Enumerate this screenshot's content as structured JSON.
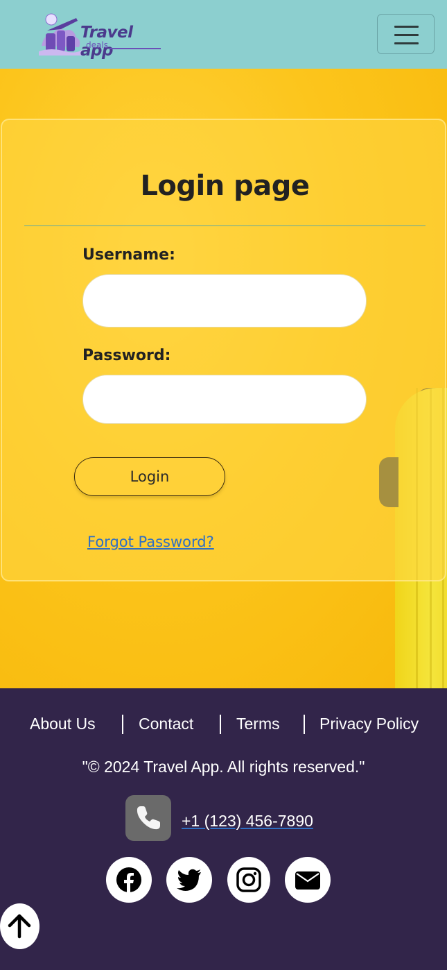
{
  "header": {
    "brand_title": "Travel app",
    "brand_subtitle": "deals",
    "menu_icon": "hamburger-icon"
  },
  "login_card": {
    "title": "Login page",
    "username_label": "Username:",
    "username_value": "",
    "password_label": "Password:",
    "password_value": "",
    "login_button": "Login",
    "forgot_link": "Forgot Password?"
  },
  "footer": {
    "links": [
      "About Us",
      "Contact",
      "Terms",
      "Privacy Policy"
    ],
    "copyright": "\"© 2024 Travel App. All rights reserved.\"",
    "phone": " +1 (123) 456-7890",
    "social_icons": [
      "facebook-icon",
      "twitter-icon",
      "instagram-icon",
      "envelope-icon"
    ],
    "back_to_top_icon": "arrow-up-icon"
  },
  "colors": {
    "navbar": "#8ccfcf",
    "hero": "#fcc51c",
    "footer": "#32254a",
    "link": "#2f6fc4"
  }
}
